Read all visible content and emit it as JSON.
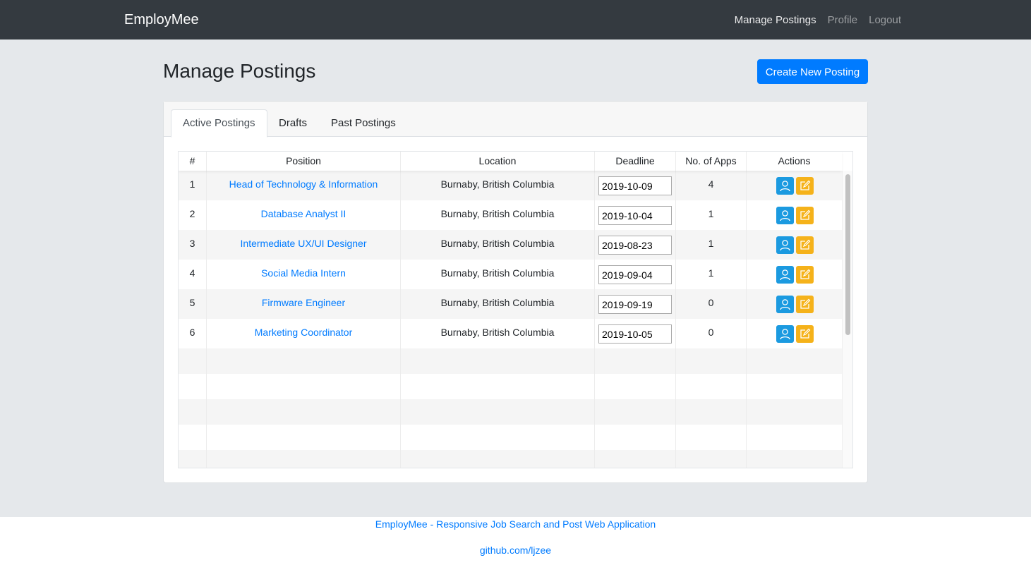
{
  "navbar": {
    "brand": "EmployMee",
    "links": [
      {
        "label": "Manage Postings",
        "active": true
      },
      {
        "label": "Profile",
        "active": false
      },
      {
        "label": "Logout",
        "active": false
      }
    ]
  },
  "header": {
    "title": "Manage Postings",
    "create_button": "Create New Posting"
  },
  "tabs": [
    {
      "label": "Active Postings",
      "active": true
    },
    {
      "label": "Drafts",
      "active": false
    },
    {
      "label": "Past Postings",
      "active": false
    }
  ],
  "table": {
    "columns": [
      "#",
      "Position",
      "Location",
      "Deadline",
      "No. of Apps",
      "Actions"
    ],
    "rows": [
      {
        "num": "1",
        "position": "Head of Technology & Information",
        "location": "Burnaby, British Columbia",
        "deadline": "2019-10-09",
        "apps": "4"
      },
      {
        "num": "2",
        "position": "Database Analyst II",
        "location": "Burnaby, British Columbia",
        "deadline": "2019-10-04",
        "apps": "1"
      },
      {
        "num": "3",
        "position": "Intermediate UX/UI Designer",
        "location": "Burnaby, British Columbia",
        "deadline": "2019-08-23",
        "apps": "1"
      },
      {
        "num": "4",
        "position": "Social Media Intern",
        "location": "Burnaby, British Columbia",
        "deadline": "2019-09-04",
        "apps": "1"
      },
      {
        "num": "5",
        "position": "Firmware Engineer",
        "location": "Burnaby, British Columbia",
        "deadline": "2019-09-19",
        "apps": "0"
      },
      {
        "num": "6",
        "position": "Marketing Coordinator",
        "location": "Burnaby, British Columbia",
        "deadline": "2019-10-05",
        "apps": "0"
      }
    ],
    "action_icons": [
      "user-icon",
      "edit-icon"
    ]
  },
  "footer": {
    "line1": "EmployMee - Responsive Job Search and Post Web Application",
    "line2": "github.com/ljzee"
  },
  "colors": {
    "navbar": "#343a40",
    "primary": "#007bff",
    "view_button": "#1b9ae0",
    "edit_button": "#f5b21a",
    "background": "#e5e8eb"
  }
}
